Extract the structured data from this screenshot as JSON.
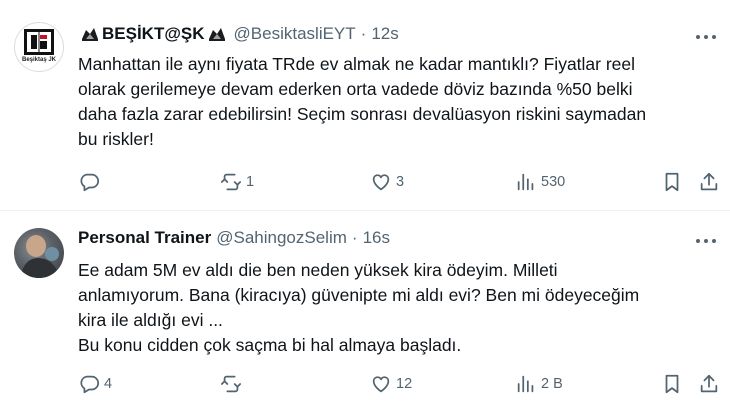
{
  "tweets": [
    {
      "display_name": "BEŞİKT@ŞK",
      "handle": "@BesiktasliEYT",
      "time": "12s",
      "avatar_caption": "Beşiktaş JK",
      "lines": [
        "Manhattan ile aynı fiyata TRde ev almak ne kadar mantıklı? Fiyatlar reel",
        "olarak gerilemeye devam ederken orta vadede döviz bazında %50 belki",
        "daha fazla zarar edebilirsin!  Seçim sonrası devalüasyon riskini saymadan",
        "bu riskler!"
      ],
      "replies": "",
      "retweets": "1",
      "likes": "3",
      "views": "530"
    },
    {
      "display_name": "Personal Trainer",
      "handle": "@SahingozSelim",
      "time": "16s",
      "lines": [
        "Ee adam 5M ev aldı die ben neden yüksek kira ödeyim. Milleti",
        "anlamıyorum. Bana (kiracıya) güvenipte mi aldı evi? Ben mi ödeyeceğim",
        "kira ile aldığı evi ...",
        "Bu konu cidden çok saçma bi hal almaya başladı."
      ],
      "replies": "4",
      "retweets": "",
      "likes": "12",
      "views": "2 B"
    }
  ],
  "separator": "·",
  "icons": {
    "reply": "reply-icon",
    "retweet": "retweet-icon",
    "like": "heart-icon",
    "views": "views-icon",
    "bookmark": "bookmark-icon",
    "share": "share-icon",
    "more": "more-icon",
    "flag": "eagle-icon"
  },
  "colors": {
    "text": "#0f1419",
    "muted": "#536471",
    "divider": "#eff3f4"
  }
}
